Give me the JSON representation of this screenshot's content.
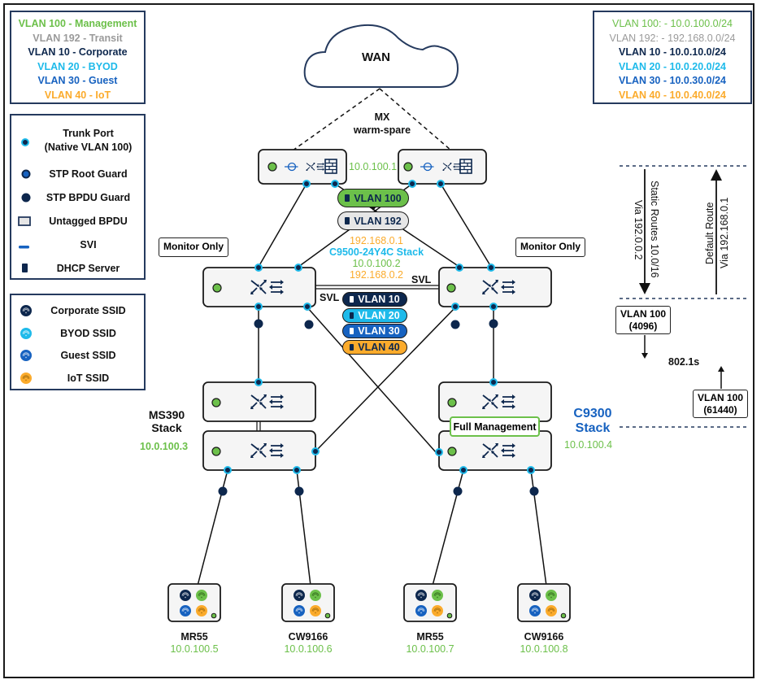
{
  "colors": {
    "management": "#6cc04a",
    "transit": "#9a9a9a",
    "corporate": "#0d274d",
    "byod": "#1ebaea",
    "guest": "#1762c0",
    "iot": "#fbab2c",
    "port_ring": "#1ebaea",
    "port_core": "#0d274d",
    "device_fill": "#f5f5f5",
    "frame": "#253a5e"
  },
  "vlan_legend": [
    {
      "text": "VLAN 100 - Management",
      "color": "#6cc04a"
    },
    {
      "text": "VLAN 192 - Transit",
      "color": "#9a9a9a"
    },
    {
      "text": "VLAN 10 - Corporate",
      "color": "#0d274d"
    },
    {
      "text": "VLAN 20 - BYOD",
      "color": "#1ebaea"
    },
    {
      "text": "VLAN 30 - Guest",
      "color": "#1762c0"
    },
    {
      "text": "VLAN 40 - IoT",
      "color": "#fbab2c"
    }
  ],
  "subnet_legend": [
    {
      "text": "VLAN 100: - 10.0.100.0/24",
      "color": "#6cc04a"
    },
    {
      "text": "VLAN 192: - 192.168.0.0/24",
      "color": "#9a9a9a"
    },
    {
      "text": "VLAN 10 - 10.0.10.0/24",
      "color": "#0d274d"
    },
    {
      "text": "VLAN 20 - 10.0.20.0/24",
      "color": "#1ebaea"
    },
    {
      "text": "VLAN 30 - 10.0.30.0/24",
      "color": "#1762c0"
    },
    {
      "text": "VLAN 40 - 10.0.40.0/24",
      "color": "#fbab2c"
    }
  ],
  "symbol_legend": {
    "trunk_port": [
      "Trunk Port",
      "(Native VLAN 100)"
    ],
    "root_guard": "STP Root Guard",
    "bpdu_guard": "STP BPDU Guard",
    "untagged_bpdu": "Untagged BPDU",
    "svi": "SVI",
    "dhcp_server": "DHCP Server"
  },
  "ssid_legend": [
    {
      "text": "Corporate SSID",
      "color": "#0d274d"
    },
    {
      "text": "BYOD SSID",
      "color": "#1ebaea"
    },
    {
      "text": "Guest SSID",
      "color": "#1762c0"
    },
    {
      "text": "IoT SSID",
      "color": "#fbab2c"
    }
  ],
  "wan": {
    "label": "WAN"
  },
  "mx": {
    "title": "MX",
    "subtitle": "warm-spare",
    "ip": "10.0.100.1"
  },
  "core_vlans": [
    {
      "label": "VLAN 100",
      "bg": "#6cc04a",
      "fg": "#0d274d"
    },
    {
      "label": "VLAN 192",
      "bg": "#e6e6e6",
      "fg": "#0d274d"
    }
  ],
  "core": {
    "gateway": "192.168.0.1",
    "name": "C9500-24Y4C Stack",
    "mgmt_ip": "10.0.100.2",
    "transit_ip": "192.168.0.2",
    "svl_left": "SVL",
    "svl_right": "SVL",
    "monitor_left": "Monitor Only",
    "monitor_right": "Monitor Only"
  },
  "svi_vlans": [
    {
      "label": "VLAN 10",
      "bg": "#0d274d",
      "fg": "#ffffff"
    },
    {
      "label": "VLAN 20",
      "bg": "#1ebaea",
      "fg": "#ffffff"
    },
    {
      "label": "VLAN 30",
      "bg": "#1762c0",
      "fg": "#ffffff"
    },
    {
      "label": "VLAN 40",
      "bg": "#fbab2c",
      "fg": "#0d274d"
    }
  ],
  "routes": {
    "static_title": "Static Routes 10.0/16",
    "static_via": "Via 192.0.0.2",
    "default_title": "Default Route",
    "default_via": "Via 192.168.0.1"
  },
  "stp": {
    "root_box": [
      "VLAN 100",
      "(4096)"
    ],
    "access_box": [
      "VLAN 100",
      "(61440)"
    ],
    "protocol": "802.1s"
  },
  "ms390": {
    "name_line1": "MS390",
    "name_line2": "Stack",
    "ip": "10.0.100.3"
  },
  "c9300": {
    "name_line1": "C9300",
    "name_line2": "Stack",
    "ip": "10.0.100.4",
    "badge": "Full Management"
  },
  "access_points": [
    {
      "model": "MR55",
      "ip": "10.0.100.5"
    },
    {
      "model": "CW9166",
      "ip": "10.0.100.6"
    },
    {
      "model": "MR55",
      "ip": "10.0.100.7"
    },
    {
      "model": "CW9166",
      "ip": "10.0.100.8"
    }
  ]
}
